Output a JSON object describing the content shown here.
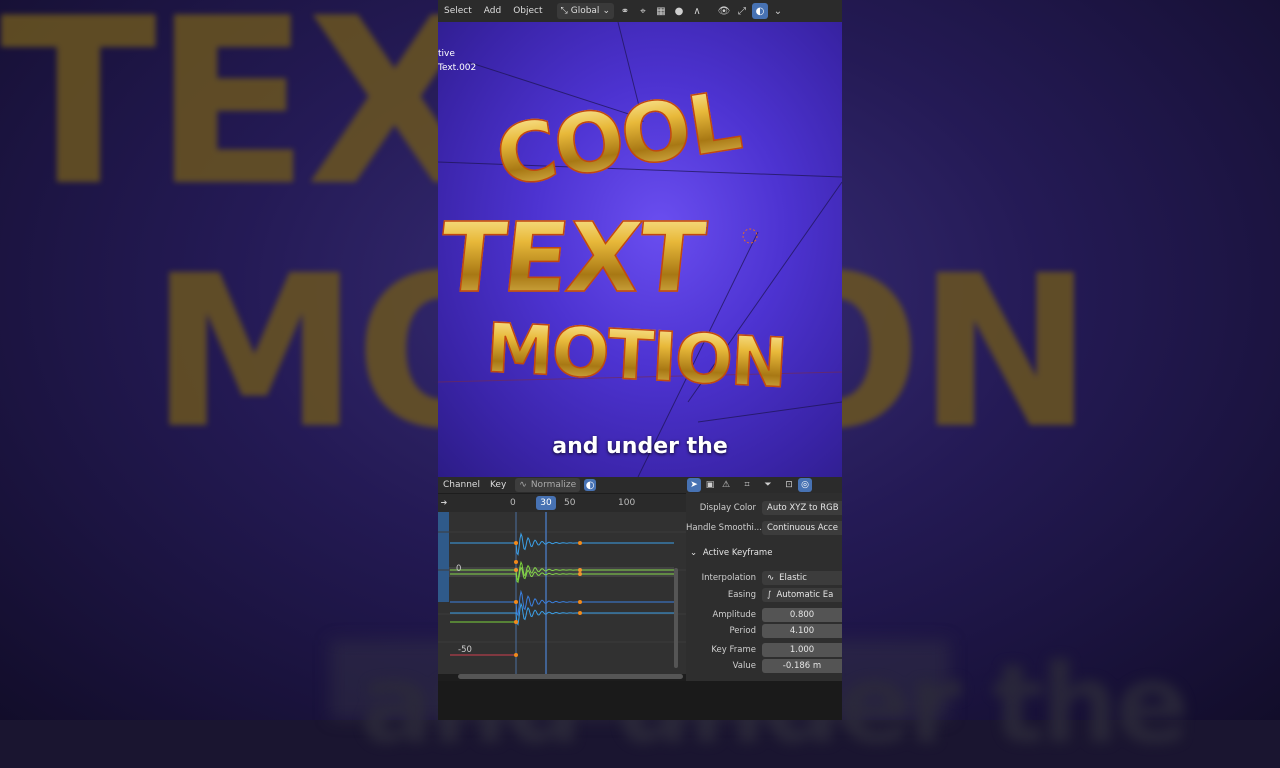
{
  "background": {
    "blur_text_top": "TEXT",
    "blur_text_mid": "MOTION",
    "blur_text_bottom": "and under the"
  },
  "viewport_header": {
    "menus": [
      "Select",
      "Add",
      "Object"
    ],
    "transform_orientation": "Global"
  },
  "viewport": {
    "info_line1": "tive",
    "info_line2": "Text.002",
    "title_lines": [
      "COOL",
      "TEXT",
      "MOTION"
    ],
    "subtitle": "and under the"
  },
  "graph_editor": {
    "menus": [
      "Channel",
      "Key"
    ],
    "normalize_label": "Normalize",
    "ruler_ticks": [
      "0",
      "50",
      "100"
    ],
    "current_frame": "30",
    "y_labels": [
      "0",
      "-50"
    ],
    "colors": {
      "x_curve": "#3aa0e8",
      "y_curve": "#7ad23a",
      "z_curve": "#3a80e0",
      "keyframe": "#f08a1c",
      "playhead": "#4772b3"
    }
  },
  "sidebar": {
    "display_color_label": "Display Color",
    "display_color_value": "Auto XYZ to RGB",
    "handle_smoothing_label": "Handle Smoothi...",
    "handle_smoothing_value": "Continuous Acce",
    "active_keyframe_header": "Active Keyframe",
    "interpolation_label": "Interpolation",
    "interpolation_value": "Elastic",
    "easing_label": "Easing",
    "easing_value": "Automatic Ea",
    "amplitude_label": "Amplitude",
    "amplitude_value": "0.800",
    "period_label": "Period",
    "period_value": "4.100",
    "key_frame_label": "Key Frame",
    "key_frame_value": "1.000",
    "value_label": "Value",
    "value_value": "-0.186 m"
  }
}
